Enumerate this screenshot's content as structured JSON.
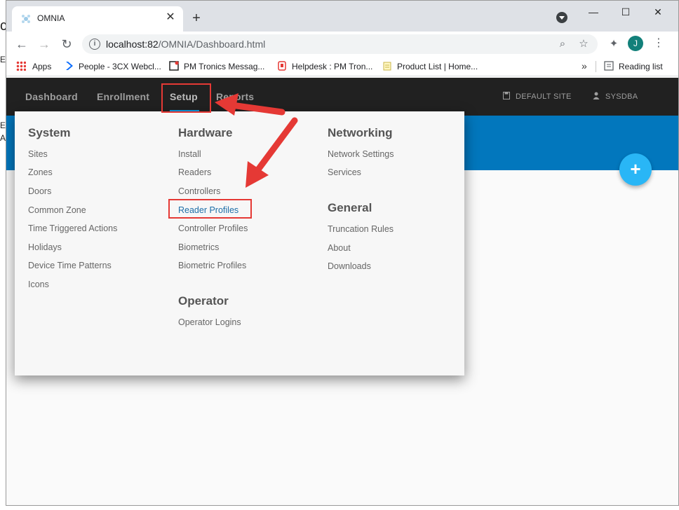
{
  "background": {
    "text1": "c",
    "text2": "E",
    "text3": "A"
  },
  "browser": {
    "tab_title": "OMNIA",
    "tab_close": "✕",
    "new_tab": "+",
    "window_minimize": "—",
    "window_maximize": "☐",
    "window_close": "✕",
    "url_host": "localhost:82",
    "url_path": "/OMNIA/Dashboard.html",
    "avatar_letter": "J",
    "bookmarks": [
      {
        "label": "Apps"
      },
      {
        "label": "People - 3CX Webcl..."
      },
      {
        "label": "PM Tronics Messag..."
      },
      {
        "label": "Helpdesk : PM Tron..."
      },
      {
        "label": "Product List | Home..."
      }
    ],
    "more_bookmarks": "»",
    "reading_list": "Reading list"
  },
  "app": {
    "nav": {
      "items": [
        "Dashboard",
        "Enrollment",
        "Setup",
        "Reports"
      ],
      "site": "DEFAULT SITE",
      "user": "SYSDBA"
    },
    "fab_label": "+",
    "menu": {
      "system": {
        "title": "System",
        "items": [
          "Sites",
          "Zones",
          "Doors",
          "Common Zone",
          "Time Triggered Actions",
          "Holidays",
          "Device Time Patterns",
          "Icons"
        ]
      },
      "hardware": {
        "title": "Hardware",
        "items": [
          "Install",
          "Readers",
          "Controllers",
          "Reader Profiles",
          "Controller Profiles",
          "Biometrics",
          "Biometric Profiles"
        ]
      },
      "operator": {
        "title": "Operator",
        "items": [
          "Operator Logins"
        ]
      },
      "networking": {
        "title": "Networking",
        "items": [
          "Network Settings",
          "Services"
        ]
      },
      "general": {
        "title": "General",
        "items": [
          "Truncation Rules",
          "About",
          "Downloads"
        ]
      }
    }
  },
  "colors": {
    "navbar": "#212121",
    "banner": "#0277bd",
    "fab": "#29b6f6",
    "annotation": "#e53935",
    "highlight_link": "#1e6fa8"
  }
}
